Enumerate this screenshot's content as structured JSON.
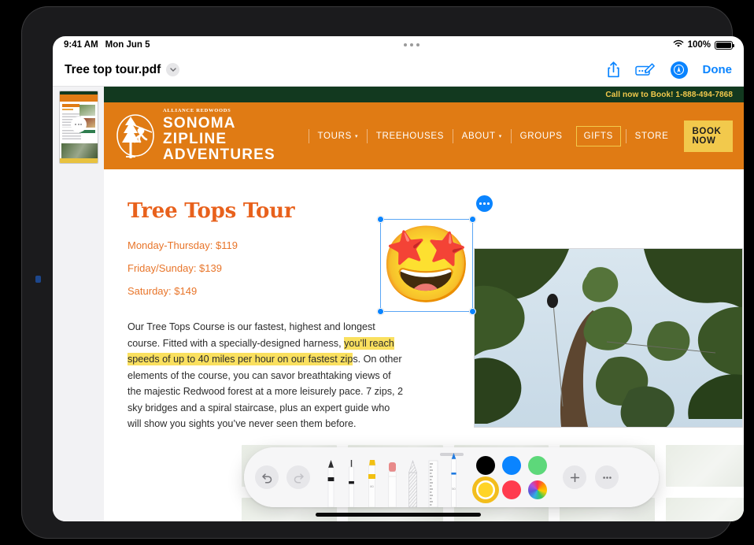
{
  "status_bar": {
    "time": "9:41 AM",
    "date": "Mon Jun 5",
    "wifi_icon": "wifi-icon",
    "battery_percent": "100%"
  },
  "doc_bar": {
    "title": "Tree top tour.pdf",
    "title_chevron_icon": "chevron-down-icon",
    "share_icon": "share-icon",
    "markup_icon": "markup-icon",
    "avatar_icon": "collaborator-avatar",
    "done_label": "Done"
  },
  "thumbnail_rail": {
    "page_badge_icon": "page-more-dots-icon"
  },
  "page": {
    "site_header": {
      "phone_banner": "Call now to Book! 1-888-494-7868",
      "logo": {
        "kicker": "ALLIANCE REDWOODS",
        "line1": "SONOMA",
        "line2": "ZIPLINE",
        "line3": "ADVENTURES",
        "mark_icon": "redwood-zipline-logo-icon"
      },
      "nav": [
        {
          "label": "TOURS",
          "caret": "▾",
          "has_caret": true
        },
        {
          "label": "TREEHOUSES",
          "has_caret": false
        },
        {
          "label": "ABOUT",
          "caret": "▾",
          "has_caret": true
        },
        {
          "label": "GROUPS",
          "has_caret": false
        }
      ],
      "gifts_label": "GIFTS",
      "store_label": "STORE",
      "book_now_label": "BOOK NOW"
    },
    "title": "Tree Tops Tour",
    "prices": [
      "Monday-Thursday: $119",
      "Friday/Sunday: $139",
      "Saturday: $149"
    ],
    "paragraph": {
      "before": "Our Tree Tops Course is our fastest, highest and longest course. Fitted with a specially-designed harness, ",
      "highlighted": "you’ll reach speeds of up to 40 miles per hour on our fastest zip",
      "after": "s. On other elements of the course, you can savor breathtaking views of the majestic Redwood forest at a more leisurely pace. 7 zips, 2 sky bridges and a spiral staircase, plus an expert guide who will show you sights you’ve never seen them before."
    },
    "photo_alt": "redwood-canopy-zipline-photo",
    "sticker": {
      "emoji": "🤩",
      "name": "star-struck-emoji-sticker",
      "more_icon": "sticker-more-options-icon"
    }
  },
  "markup_toolbar": {
    "undo_icon": "undo-icon",
    "redo_icon": "redo-icon",
    "tools": [
      {
        "name": "pen-tool",
        "selected": false
      },
      {
        "name": "fountain-pen-tool",
        "selected": false
      },
      {
        "name": "highlighter-tool",
        "selected": false
      },
      {
        "name": "eraser-tool",
        "selected": false
      },
      {
        "name": "lasso-tool",
        "selected": false
      },
      {
        "name": "ruler-tool",
        "selected": false
      },
      {
        "name": "blue-pen-tool",
        "selected": true
      }
    ],
    "colors": [
      {
        "name": "black",
        "hex": "#000000",
        "selected": false
      },
      {
        "name": "blue",
        "hex": "#0a84ff",
        "selected": false
      },
      {
        "name": "green",
        "hex": "#5dd87a",
        "selected": false
      },
      {
        "name": "yellow",
        "hex": "#ffd426",
        "selected": true
      },
      {
        "name": "red",
        "hex": "#ff3b4e",
        "selected": false
      },
      {
        "name": "color-wheel",
        "hex": "rainbow",
        "selected": false
      }
    ],
    "add_icon": "add-plus-icon",
    "more_icon": "more-options-icon"
  }
}
